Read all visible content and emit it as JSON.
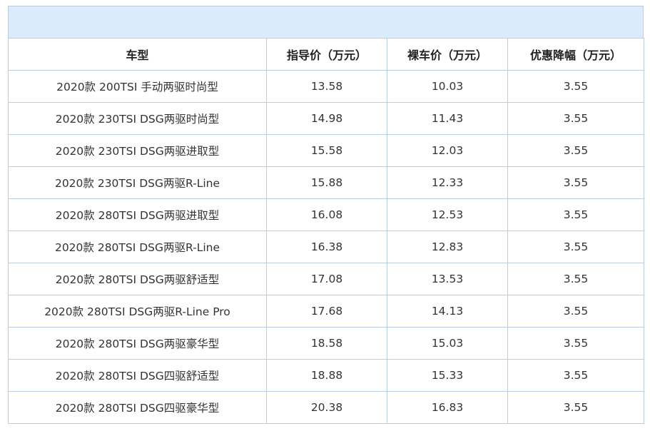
{
  "table": {
    "headers": [
      "车型",
      "指导价（万元）",
      "裸车价（万元）",
      "优惠降幅（万元）"
    ],
    "rows": [
      [
        "2020款 200TSI 手动两驱时尚型",
        "13.58",
        "10.03",
        "3.55"
      ],
      [
        "2020款 230TSI DSG两驱时尚型",
        "14.98",
        "11.43",
        "3.55"
      ],
      [
        "2020款 230TSI DSG两驱进取型",
        "15.58",
        "12.03",
        "3.55"
      ],
      [
        "2020款 230TSI DSG两驱R-Line",
        "15.88",
        "12.33",
        "3.55"
      ],
      [
        "2020款 280TSI DSG两驱进取型",
        "16.08",
        "12.53",
        "3.55"
      ],
      [
        "2020款 280TSI DSG两驱R-Line",
        "16.38",
        "12.83",
        "3.55"
      ],
      [
        "2020款 280TSI DSG两驱舒适型",
        "17.08",
        "13.53",
        "3.55"
      ],
      [
        "2020款 280TSI DSG两驱R-Line Pro",
        "17.68",
        "14.13",
        "3.55"
      ],
      [
        "2020款 280TSI DSG两驱豪华型",
        "18.58",
        "15.03",
        "3.55"
      ],
      [
        "2020款 280TSI DSG四驱舒适型",
        "18.88",
        "15.33",
        "3.55"
      ],
      [
        "2020款 280TSI DSG四驱豪华型",
        "20.38",
        "16.83",
        "3.55"
      ]
    ]
  }
}
